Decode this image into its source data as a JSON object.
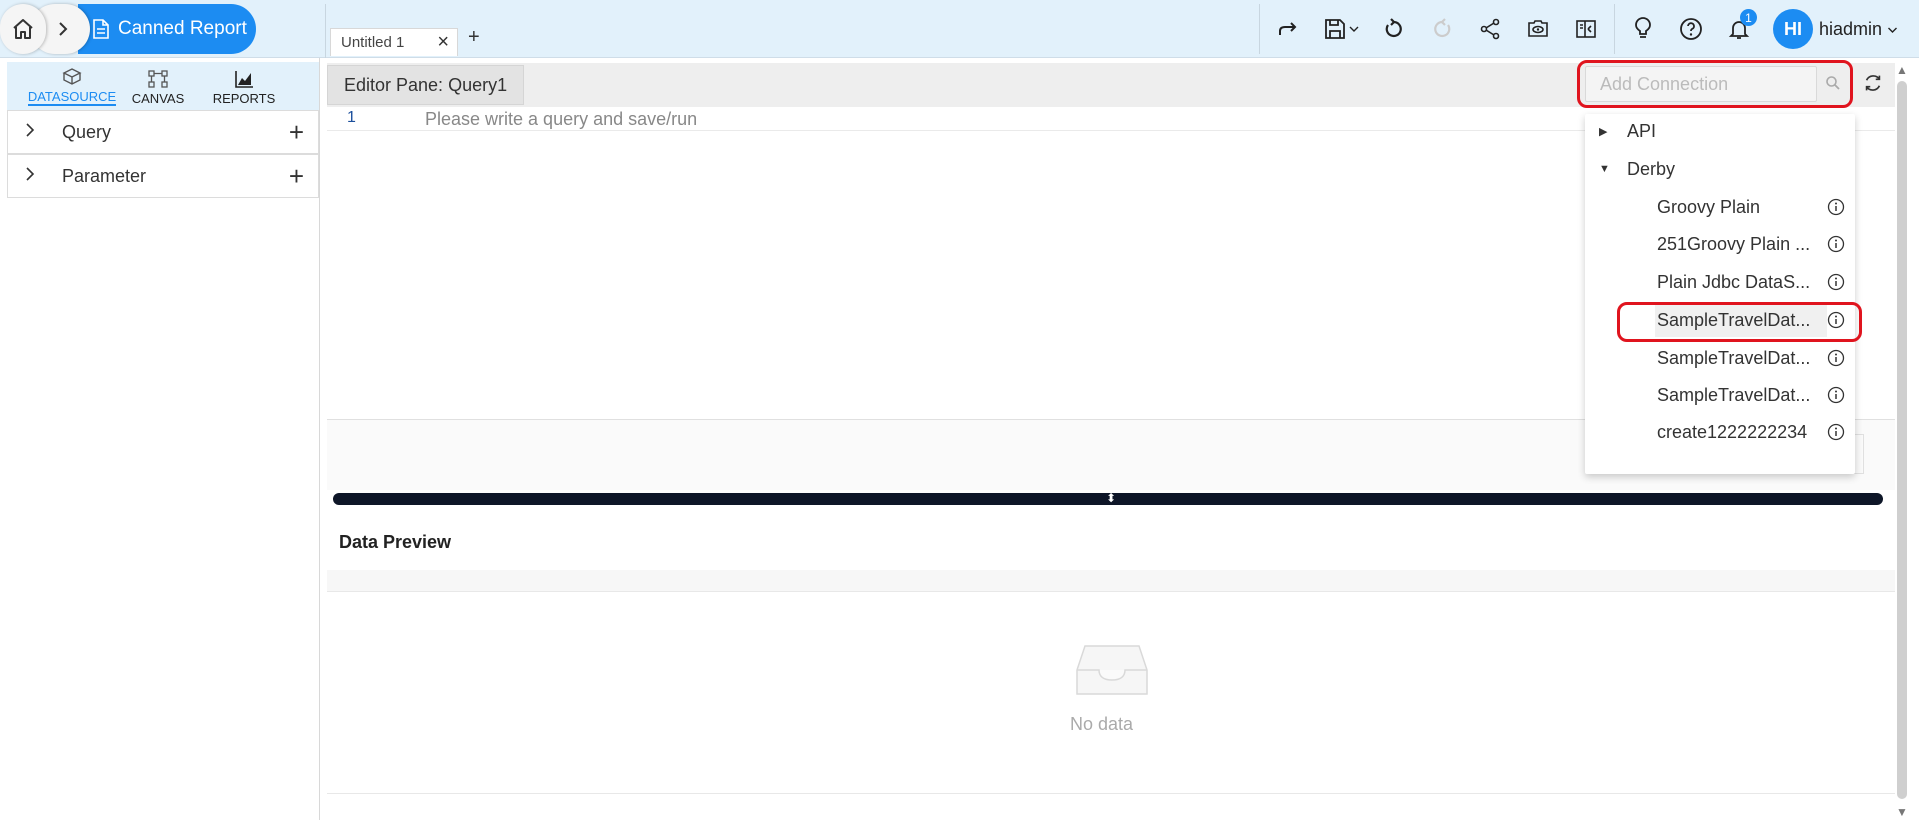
{
  "breadcrumb": {
    "current": "Canned Report"
  },
  "tabs": {
    "items": [
      {
        "label": "Untitled 1"
      }
    ]
  },
  "user": {
    "initials": "HI",
    "name": "hiadmin"
  },
  "notifications": {
    "count": "1"
  },
  "sidebar": {
    "tabs": [
      {
        "label": "DATASOURCE",
        "icon": "database-icon",
        "active": true
      },
      {
        "label": "CANVAS",
        "icon": "canvas-icon",
        "active": false
      },
      {
        "label": "REPORTS",
        "icon": "chart-icon",
        "active": false
      }
    ],
    "sections": [
      {
        "label": "Query"
      },
      {
        "label": "Parameter"
      }
    ]
  },
  "editor": {
    "title": "Editor Pane: Query1",
    "line_number": "1",
    "hint": "Please write a query and save/run"
  },
  "preview": {
    "title": "Data Preview",
    "empty_text": "No data"
  },
  "connection": {
    "search_placeholder": "Add Connection",
    "groups": [
      {
        "label": "API",
        "expanded": false
      },
      {
        "label": "Derby",
        "expanded": true,
        "items": [
          "Groovy Plain",
          "251Groovy Plain ...",
          "Plain Jdbc DataS...",
          "SampleTravelDat...",
          "SampleTravelDat...",
          "SampleTravelDat...",
          "create1222222234"
        ]
      }
    ]
  },
  "colors": {
    "accent": "#1c8cf2",
    "topbar_bg": "#e2f1fb",
    "highlight": "#e0141e",
    "splitter": "#0e1628"
  }
}
